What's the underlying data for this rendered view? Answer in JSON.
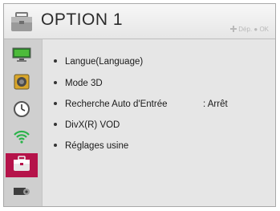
{
  "header": {
    "title": "OPTION 1",
    "hint_text": "Dép. ● OK",
    "icon": "toolbox-icon"
  },
  "sidebar": {
    "items": [
      {
        "name": "picture",
        "icon": "monitor-icon",
        "selected": false
      },
      {
        "name": "sound",
        "icon": "speaker-icon",
        "selected": false
      },
      {
        "name": "time",
        "icon": "clock-icon",
        "selected": false
      },
      {
        "name": "network",
        "icon": "wifi-icon",
        "selected": false
      },
      {
        "name": "option",
        "icon": "toolbox-icon",
        "selected": true
      },
      {
        "name": "support",
        "icon": "settings-device-icon",
        "selected": false
      }
    ]
  },
  "menu": {
    "items": [
      {
        "label": "Langue(Language)",
        "value": ""
      },
      {
        "label": "Mode 3D",
        "value": ""
      },
      {
        "label": "Recherche Auto d'Entrée",
        "value": ": Arrêt"
      },
      {
        "label": "DivX(R) VOD",
        "value": ""
      },
      {
        "label": "Réglages usine",
        "value": ""
      }
    ]
  },
  "colors": {
    "accent": "#b5134a",
    "panel_bg": "#e6e6e6",
    "sidebar_bg": "#cfcfcf"
  }
}
